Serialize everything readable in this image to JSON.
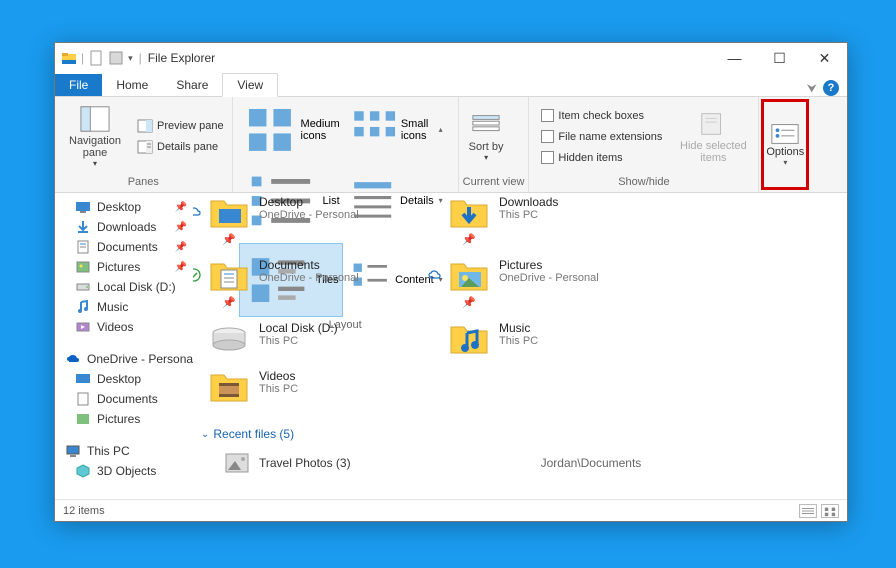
{
  "window": {
    "title": "File Explorer",
    "controls": {
      "min": "—",
      "max": "☐",
      "close": "✕"
    }
  },
  "tabs": {
    "file": "File",
    "home": "Home",
    "share": "Share",
    "view": "View"
  },
  "ribbon": {
    "panes": {
      "label": "Panes",
      "navigation": "Navigation pane",
      "preview": "Preview pane",
      "details": "Details pane"
    },
    "layout": {
      "label": "Layout",
      "medium": "Medium icons",
      "small": "Small icons",
      "list": "List",
      "details": "Details",
      "tiles": "Tiles",
      "content": "Content"
    },
    "current_view": {
      "label": "Current view",
      "sort": "Sort by"
    },
    "show_hide": {
      "label": "Show/hide",
      "item_check": "Item check boxes",
      "file_ext": "File name extensions",
      "hidden": "Hidden items",
      "hide_selected": "Hide selected items"
    },
    "options": "Options"
  },
  "nav": {
    "desktop": "Desktop",
    "downloads": "Downloads",
    "documents": "Documents",
    "pictures": "Pictures",
    "local_disk": "Local Disk (D:)",
    "music": "Music",
    "videos": "Videos",
    "onedrive": "OneDrive - Personal",
    "od_desktop": "Desktop",
    "od_documents": "Documents",
    "od_pictures": "Pictures",
    "this_pc": "This PC",
    "3d_objects": "3D Objects"
  },
  "tiles": [
    {
      "name": "Desktop",
      "sub": "OneDrive - Personal",
      "pinned": true,
      "icon": "desktop",
      "side": "cloud"
    },
    {
      "name": "Downloads",
      "sub": "This PC",
      "pinned": true,
      "icon": "downloads",
      "side": ""
    },
    {
      "name": "Documents",
      "sub": "OneDrive - Personal",
      "pinned": true,
      "icon": "documents",
      "side": "check"
    },
    {
      "name": "Pictures",
      "sub": "OneDrive - Personal",
      "pinned": true,
      "icon": "pictures",
      "side": "cloud"
    },
    {
      "name": "Local Disk (D:)",
      "sub": "This PC",
      "pinned": false,
      "icon": "disk",
      "side": ""
    },
    {
      "name": "Music",
      "sub": "This PC",
      "pinned": false,
      "icon": "music",
      "side": ""
    },
    {
      "name": "Videos",
      "sub": "This PC",
      "pinned": false,
      "icon": "videos",
      "side": ""
    }
  ],
  "recent": {
    "header": "Recent files (5)",
    "items": [
      {
        "name": "Travel Photos (3)",
        "location": "Jordan\\Documents"
      }
    ]
  },
  "status": {
    "count": "12 items"
  }
}
